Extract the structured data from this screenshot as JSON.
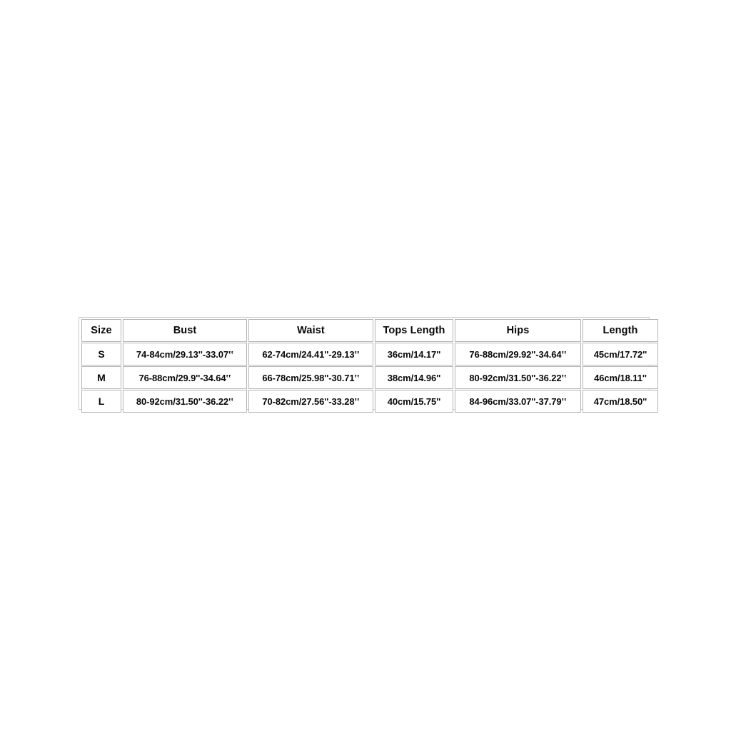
{
  "size_chart": {
    "columns": [
      {
        "key": "size",
        "label": "Size"
      },
      {
        "key": "bust",
        "label": "Bust"
      },
      {
        "key": "waist",
        "label": "Waist"
      },
      {
        "key": "tops_length",
        "label": "Tops Length"
      },
      {
        "key": "hips",
        "label": "Hips"
      },
      {
        "key": "length",
        "label": "Length"
      }
    ],
    "rows": [
      {
        "size": "S",
        "bust": "74-84cm/29.13''-33.07‛‛",
        "waist": "62-74cm/24.41''-29.13‛‛",
        "tops_length": "36cm/14.17''",
        "hips": "76-88cm/29.92''-34.64‛‛",
        "length": "45cm/17.72''"
      },
      {
        "size": "M",
        "bust": "76-88cm/29.9''-34.64‛‛",
        "waist": "66-78cm/25.98''-30.71‛‛",
        "tops_length": "38cm/14.96''",
        "hips": "80-92cm/31.50''-36.22‛‛",
        "length": "46cm/18.11''"
      },
      {
        "size": "L",
        "bust": "80-92cm/31.50''-36.22‛‛",
        "waist": "70-82cm/27.56''-33.28‛‛",
        "tops_length": "40cm/15.75''",
        "hips": "84-96cm/33.07''-37.79‛‛",
        "length": "47cm/18.50''"
      }
    ]
  },
  "colors": {
    "background": "#ffffff",
    "text": "#080808",
    "outer_border": "#c9c9c9",
    "cell_border": "#b4b4b4"
  }
}
